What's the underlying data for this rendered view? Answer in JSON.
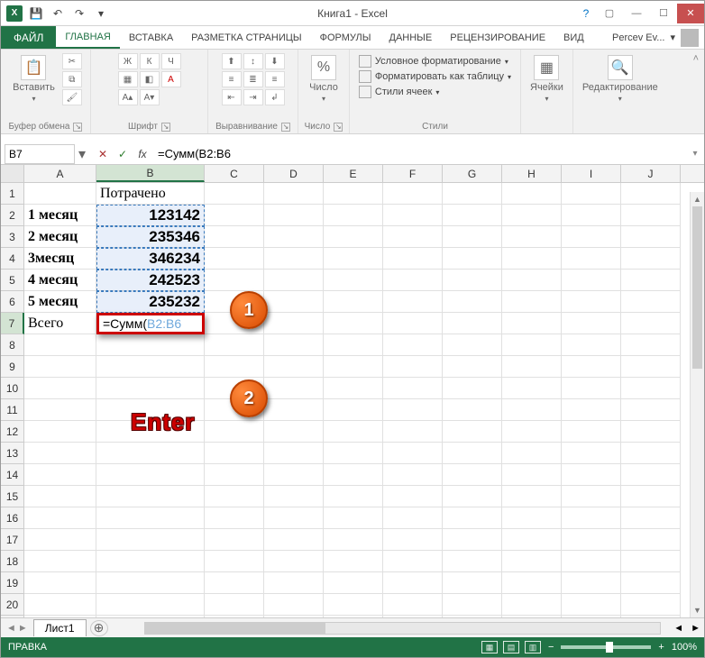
{
  "window": {
    "title": "Книга1 - Excel"
  },
  "qat": {
    "save_tip": "Сохранить",
    "undo_tip": "Отменить",
    "redo_tip": "Повторить"
  },
  "tabs": {
    "file": "ФАЙЛ",
    "items": [
      "ГЛАВНАЯ",
      "ВСТАВКА",
      "РАЗМЕТКА СТРАНИЦЫ",
      "ФОРМУЛЫ",
      "ДАННЫЕ",
      "РЕЦЕНЗИРОВАНИЕ",
      "ВИД"
    ],
    "active_index": 0,
    "user": "Percev Ev..."
  },
  "ribbon": {
    "clipboard": {
      "paste": "Вставить",
      "label": "Буфер обмена"
    },
    "font": {
      "label": "Шрифт"
    },
    "alignment": {
      "label": "Выравнивание"
    },
    "number": {
      "btn": "Число",
      "label": "Число"
    },
    "styles": {
      "cond_format": "Условное форматирование",
      "as_table": "Форматировать как таблицу",
      "cell_styles": "Стили ячеек",
      "label": "Стили"
    },
    "cells": {
      "btn": "Ячейки"
    },
    "editing": {
      "btn": "Редактирование"
    }
  },
  "namebox": {
    "value": "B7"
  },
  "formula_bar": {
    "value": "=Сумм(B2:B6"
  },
  "columns": [
    "A",
    "B",
    "C",
    "D",
    "E",
    "F",
    "G",
    "H",
    "I",
    "J"
  ],
  "col_widths": {
    "A": 80,
    "B": 120
  },
  "selected_col": "B",
  "selected_row": 7,
  "row_count": 21,
  "cells": {
    "B1": "Потрачено",
    "A2": "1 месяц",
    "B2": "123142",
    "A3": "2 месяц",
    "B3": "235346",
    "A4": "3месяц",
    "B4": "346234",
    "A5": "4 месяц",
    "B5": "242523",
    "A6": "5 месяц",
    "B6": "235232",
    "A7": "Всего"
  },
  "editing_cell": {
    "ref": "B7",
    "prefix": "=Сумм(",
    "range": "B2:B6"
  },
  "annotations": {
    "callout1": "1",
    "callout2": "2",
    "enter": "Enter"
  },
  "sheet_tabs": {
    "active": "Лист1"
  },
  "status": {
    "mode": "ПРАВКА",
    "zoom": "100%"
  }
}
